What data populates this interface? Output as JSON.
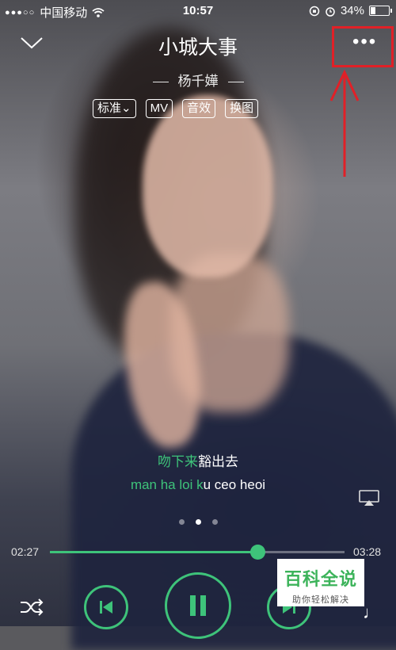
{
  "status_bar": {
    "carrier": "中国移动",
    "time": "10:57",
    "battery_percent": "34%",
    "battery_level": 0.34
  },
  "header": {
    "title": "小城大事",
    "artist": "杨千嬅"
  },
  "options": {
    "quality": "标准",
    "mv": "MV",
    "effects": "音效",
    "change_image": "换图"
  },
  "lyrics": {
    "line_sung": "吻下来",
    "line_rest": "豁出去",
    "romanization_sung": "man ha loi k",
    "romanization_rest": "u ceo heoi"
  },
  "pager": {
    "count": 3,
    "active_index": 1
  },
  "progress": {
    "elapsed": "02:27",
    "total": "03:28",
    "fraction": 0.706
  },
  "watermark": {
    "title": "百科全说",
    "subtitle": "助你轻松解决"
  },
  "colors": {
    "accent": "#3ec37a",
    "annotation": "#e12027"
  }
}
